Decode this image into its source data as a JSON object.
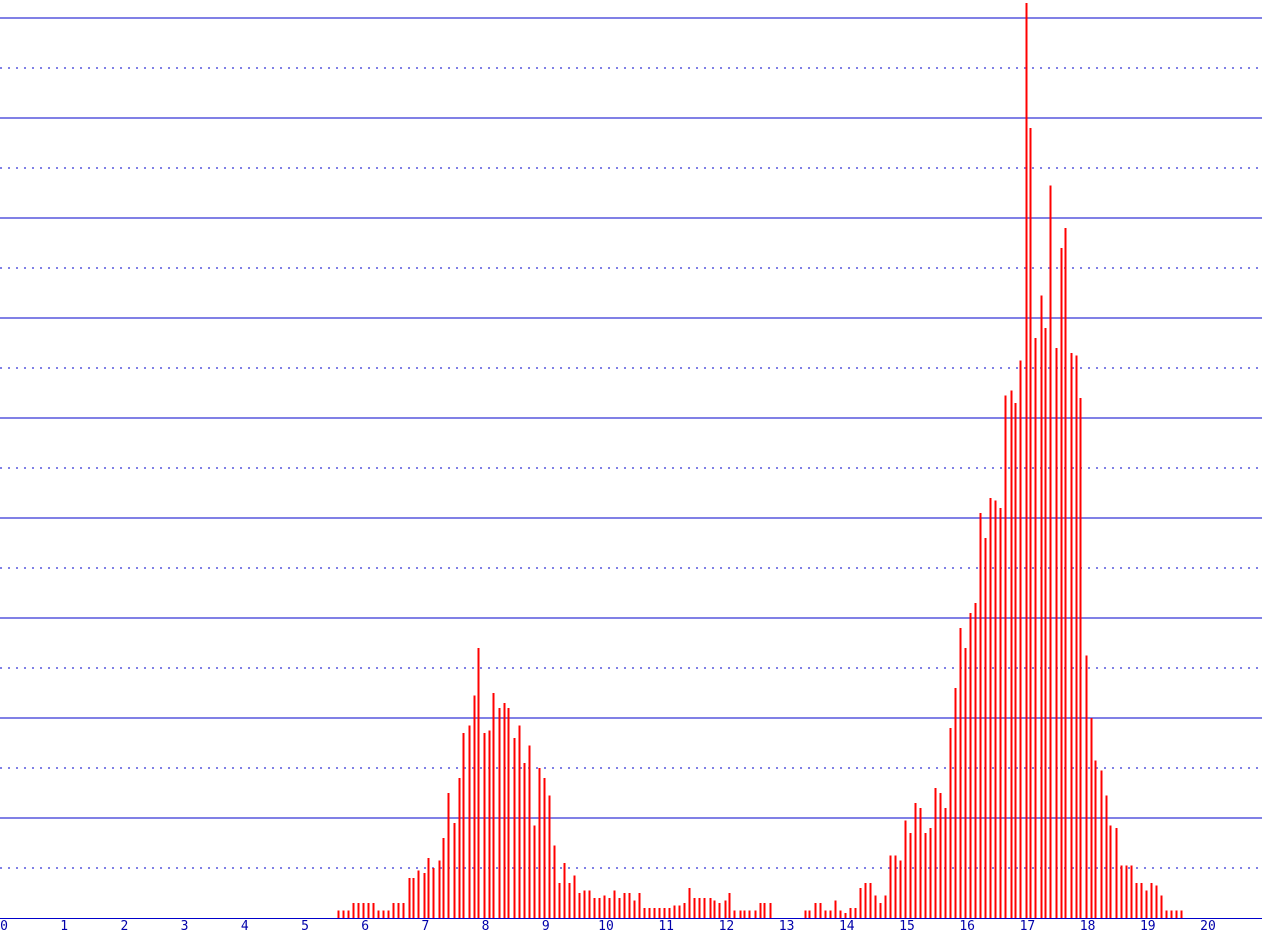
{
  "chart_data": {
    "type": "bar",
    "title": "",
    "xlabel": "",
    "ylabel": "",
    "xlim": [
      0,
      21
    ],
    "ylim": [
      0,
      18
    ],
    "x_ticks": [
      "0",
      "1",
      "2",
      "3",
      "4",
      "5",
      "6",
      "7",
      "8",
      "9",
      "10",
      "11",
      "12",
      "13",
      "14",
      "15",
      "16",
      "17",
      "18",
      "19",
      "20"
    ],
    "grid": {
      "major_solid": true,
      "minor_dotted": true
    },
    "colors": {
      "bars": "#ff0000",
      "grid": "#0000cc",
      "axis": "#0000cc",
      "tick_labels": "#0000aa",
      "background": "#ffffff"
    },
    "series": [
      {
        "x": [
          5.55,
          5.63,
          5.72,
          5.8,
          5.88,
          5.97,
          6.05,
          6.13,
          6.22,
          6.3,
          6.38,
          6.47,
          6.55,
          6.63,
          6.72,
          6.8,
          6.88,
          6.97,
          7.05,
          7.13,
          7.22,
          7.3,
          7.38,
          7.47,
          7.55,
          7.63,
          7.72,
          7.8,
          7.88,
          7.97,
          8.05,
          8.13,
          8.22,
          8.3,
          8.38,
          8.47,
          8.55,
          8.63,
          8.72,
          8.8,
          8.88,
          8.97,
          9.05,
          9.13,
          9.22,
          9.3,
          9.38,
          9.47,
          9.55,
          9.63,
          9.72,
          9.8,
          9.88,
          9.97,
          10.05,
          10.13,
          10.22,
          10.3,
          10.38,
          10.47,
          10.55,
          10.63,
          10.72,
          10.8,
          10.88,
          10.97,
          11.05,
          11.13,
          11.22,
          11.3,
          11.38,
          11.47,
          11.55,
          11.63,
          11.72,
          11.8,
          11.88,
          11.97,
          12.05,
          12.13,
          12.22,
          12.3,
          12.38,
          12.47,
          12.55,
          12.63,
          12.72,
          13.3,
          13.38,
          13.47,
          13.55,
          13.63,
          13.72,
          13.8,
          13.88,
          13.97,
          14.05,
          14.13,
          14.22,
          14.3,
          14.38,
          14.47,
          14.55,
          14.63,
          14.72,
          14.8,
          14.88,
          14.97,
          15.05,
          15.13,
          15.22,
          15.3,
          15.38,
          15.47,
          15.55,
          15.63,
          15.72,
          15.8,
          15.88,
          15.97,
          16.05,
          16.13,
          16.22,
          16.3,
          16.38,
          16.47,
          16.55,
          16.63,
          16.72,
          16.8,
          16.88,
          16.97,
          17.05,
          17.13,
          17.22,
          17.3,
          17.38,
          17.47,
          17.55,
          17.63,
          17.72,
          17.8,
          17.88,
          17.97,
          18.05,
          18.13,
          18.22,
          18.3,
          18.38,
          18.47,
          18.55,
          18.63,
          18.72,
          18.8,
          18.88,
          18.97,
          19.05,
          19.13,
          19.22,
          19.3,
          19.38,
          19.47,
          19.55
        ],
        "values": [
          0.15,
          0.15,
          0.15,
          0.3,
          0.3,
          0.3,
          0.3,
          0.3,
          0.15,
          0.15,
          0.15,
          0.3,
          0.3,
          0.3,
          0.8,
          0.8,
          0.95,
          0.9,
          1.2,
          1.0,
          1.15,
          1.6,
          2.5,
          1.9,
          2.8,
          3.7,
          3.85,
          4.45,
          5.4,
          3.7,
          3.75,
          4.5,
          4.2,
          4.3,
          4.2,
          3.6,
          3.85,
          3.1,
          3.45,
          1.85,
          3.0,
          2.8,
          2.45,
          1.45,
          0.7,
          1.1,
          0.7,
          0.85,
          0.5,
          0.55,
          0.55,
          0.4,
          0.4,
          0.45,
          0.4,
          0.55,
          0.4,
          0.5,
          0.5,
          0.35,
          0.5,
          0.2,
          0.2,
          0.2,
          0.2,
          0.2,
          0.2,
          0.25,
          0.25,
          0.3,
          0.6,
          0.4,
          0.4,
          0.4,
          0.4,
          0.35,
          0.3,
          0.35,
          0.5,
          0.15,
          0.15,
          0.15,
          0.15,
          0.15,
          0.3,
          0.3,
          0.3,
          0.15,
          0.15,
          0.3,
          0.3,
          0.15,
          0.15,
          0.35,
          0.15,
          0.1,
          0.2,
          0.2,
          0.6,
          0.7,
          0.7,
          0.45,
          0.3,
          0.45,
          1.25,
          1.25,
          1.15,
          1.95,
          1.7,
          2.3,
          2.2,
          1.7,
          1.8,
          2.6,
          2.5,
          2.2,
          3.8,
          4.6,
          5.8,
          5.4,
          6.1,
          6.3,
          8.1,
          7.6,
          8.4,
          8.35,
          8.2,
          10.45,
          10.55,
          10.3,
          11.15,
          18.3,
          15.8,
          11.6,
          12.45,
          11.8,
          14.65,
          11.4,
          13.4,
          13.8,
          11.3,
          11.25,
          10.4,
          5.25,
          4.0,
          3.15,
          2.95,
          2.45,
          1.85,
          1.8,
          1.05,
          1.05,
          1.05,
          0.7,
          0.7,
          0.55,
          0.7,
          0.65,
          0.45,
          0.15,
          0.15,
          0.15,
          0.15
        ]
      }
    ]
  }
}
